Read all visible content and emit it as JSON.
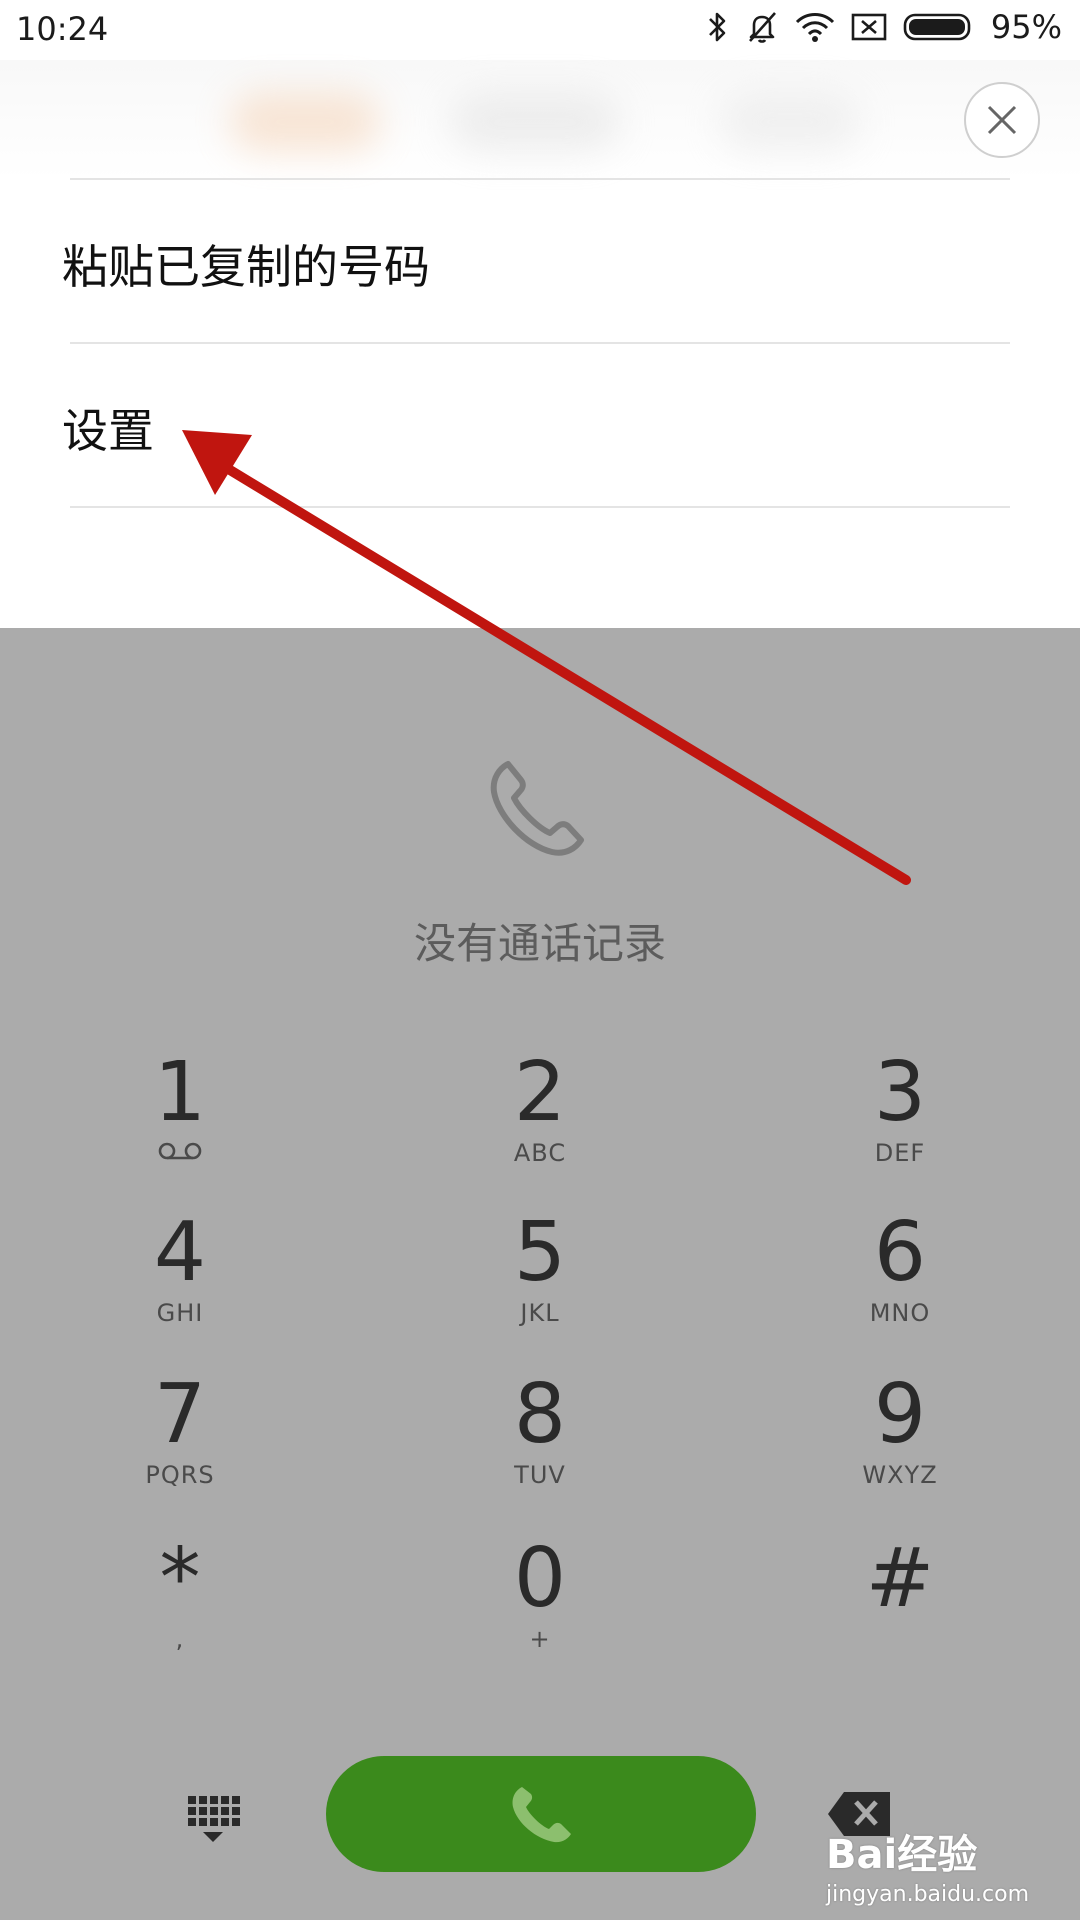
{
  "status_bar": {
    "time": "10:24",
    "battery_percent": "95%",
    "icons": [
      "bluetooth-icon",
      "mute-bell-icon",
      "wifi-icon",
      "no-sim-icon",
      "battery-icon"
    ]
  },
  "menu": {
    "close_icon": "close-icon",
    "items": [
      {
        "label": "粘贴已复制的号码"
      },
      {
        "label": "设置"
      }
    ]
  },
  "dialer": {
    "empty_state": {
      "icon": "phone-outline-icon",
      "text": "没有通话记录"
    },
    "keys": [
      {
        "digit": "1",
        "letters": "voicemail-icon"
      },
      {
        "digit": "2",
        "letters": "ABC"
      },
      {
        "digit": "3",
        "letters": "DEF"
      },
      {
        "digit": "4",
        "letters": "GHI"
      },
      {
        "digit": "5",
        "letters": "JKL"
      },
      {
        "digit": "6",
        "letters": "MNO"
      },
      {
        "digit": "7",
        "letters": "PQRS"
      },
      {
        "digit": "8",
        "letters": "TUV"
      },
      {
        "digit": "9",
        "letters": "WXYZ"
      },
      {
        "digit": "*",
        "letters": ","
      },
      {
        "digit": "0",
        "letters": "+"
      },
      {
        "digit": "#",
        "letters": ""
      }
    ],
    "bottom": {
      "dialpad_icon": "dialpad-toggle-icon",
      "call_icon": "phone-icon",
      "backspace_icon": "backspace-icon"
    }
  },
  "colors": {
    "call_green": "#3b8a1c",
    "overlay_gray": "#ababab",
    "annotation_red": "#c0150f"
  },
  "watermark": {
    "logo": "Bai经验",
    "url": "jingyan.baidu.com"
  }
}
